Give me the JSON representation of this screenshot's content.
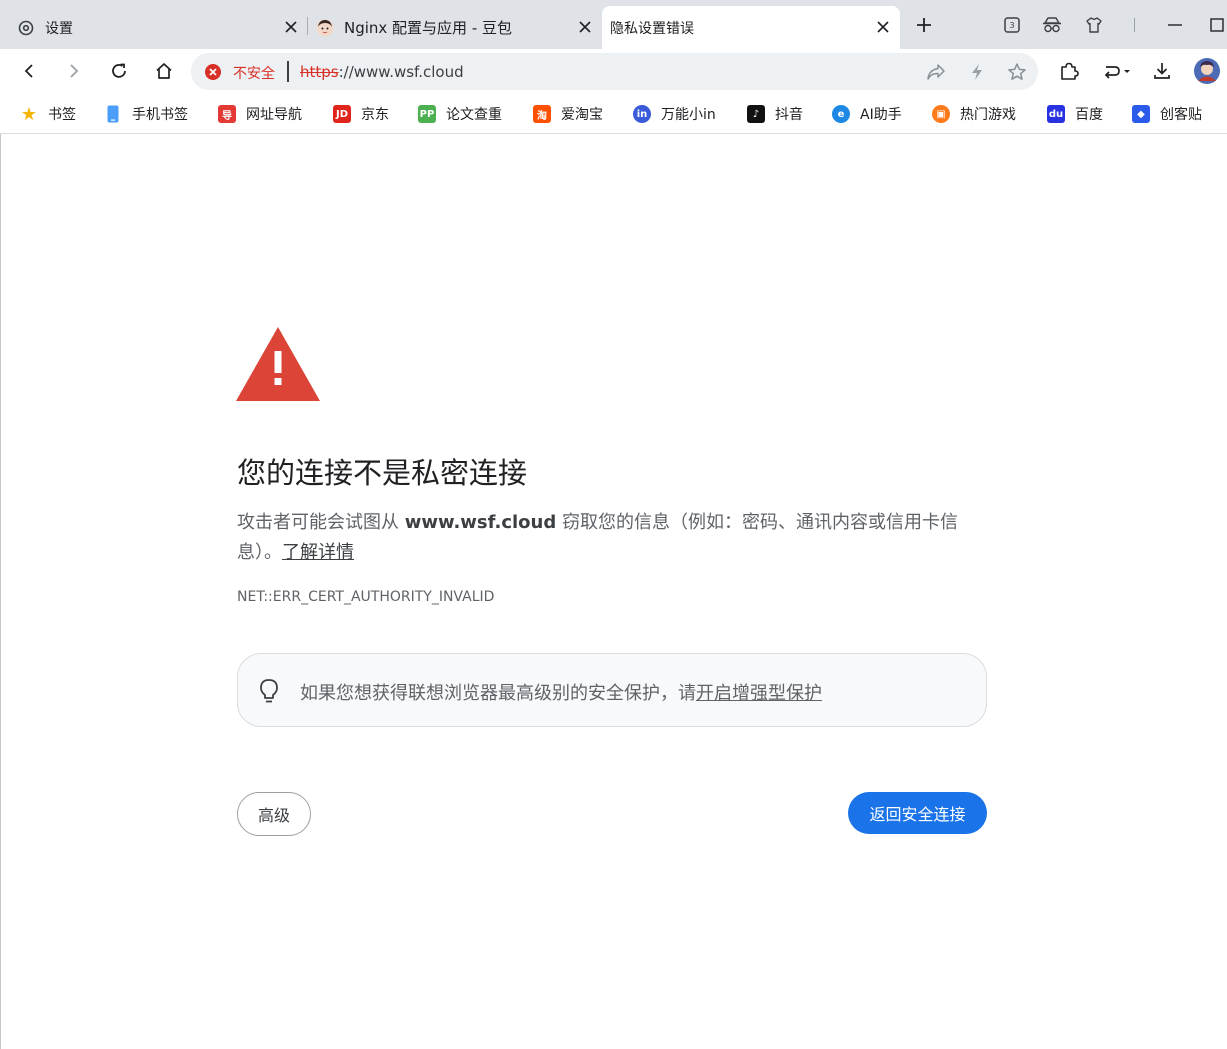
{
  "tabs": [
    {
      "title": "设置",
      "icon": "settings-gear-icon",
      "active": false
    },
    {
      "title": "Nginx 配置与应用 - 豆包",
      "icon": "doubao-avatar-icon",
      "active": false
    },
    {
      "title": "隐私设置错误",
      "icon": "",
      "active": true
    }
  ],
  "tabstrip": {
    "new_tab_label": "+",
    "tab_count": "3"
  },
  "omnibox": {
    "security_label": "不安全",
    "url_scheme": "https",
    "url_rest": "://www.wsf.cloud"
  },
  "bookmarks": [
    {
      "label": "书签",
      "icon": "star-icon",
      "color": "#f5b400",
      "glyph": "★"
    },
    {
      "label": "手机书签",
      "icon": "phone-icon",
      "color": "#4a9df8",
      "glyph": ""
    },
    {
      "label": "网址导航",
      "icon": "navigation-icon",
      "color": "#e53935",
      "glyph": "导"
    },
    {
      "label": "京东",
      "icon": "jd-icon",
      "color": "#e1251b",
      "glyph": "JD"
    },
    {
      "label": "论文查重",
      "icon": "pp-icon",
      "color": "#4caf50",
      "glyph": "PP"
    },
    {
      "label": "爱淘宝",
      "icon": "taobao-icon",
      "color": "#ff5000",
      "glyph": "淘"
    },
    {
      "label": "万能小in",
      "icon": "robot-icon",
      "color": "#3a5bd9",
      "glyph": "in"
    },
    {
      "label": "抖音",
      "icon": "douyin-icon",
      "color": "#111111",
      "glyph": "♪"
    },
    {
      "label": "AI助手",
      "icon": "ai-assistant-icon",
      "color": "#1e88e5",
      "glyph": "e"
    },
    {
      "label": "热门游戏",
      "icon": "game-icon",
      "color": "#ff7a1a",
      "glyph": "▣"
    },
    {
      "label": "百度",
      "icon": "baidu-icon",
      "color": "#2932e1",
      "glyph": "du"
    },
    {
      "label": "创客贴",
      "icon": "chuangketie-icon",
      "color": "#2a5bea",
      "glyph": "◆"
    }
  ],
  "error_page": {
    "heading": "您的连接不是私密连接",
    "desc_prefix": "攻击者可能会试图从 ",
    "desc_host": "www.wsf.cloud",
    "desc_suffix": " 窃取您的信息（例如：密码、通讯内容或信用卡信息）。",
    "learn_more": "了解详情",
    "error_code": "NET::ERR_CERT_AUTHORITY_INVALID",
    "tip_text": "如果您想获得联想浏览器最高级别的安全保护，请",
    "tip_link": "开启增强型保护",
    "advanced_button": "高级",
    "back_button": "返回安全连接"
  },
  "colors": {
    "accent_blue": "#1a73e8",
    "danger_red": "#d93025",
    "triangle_red": "#db4437"
  }
}
